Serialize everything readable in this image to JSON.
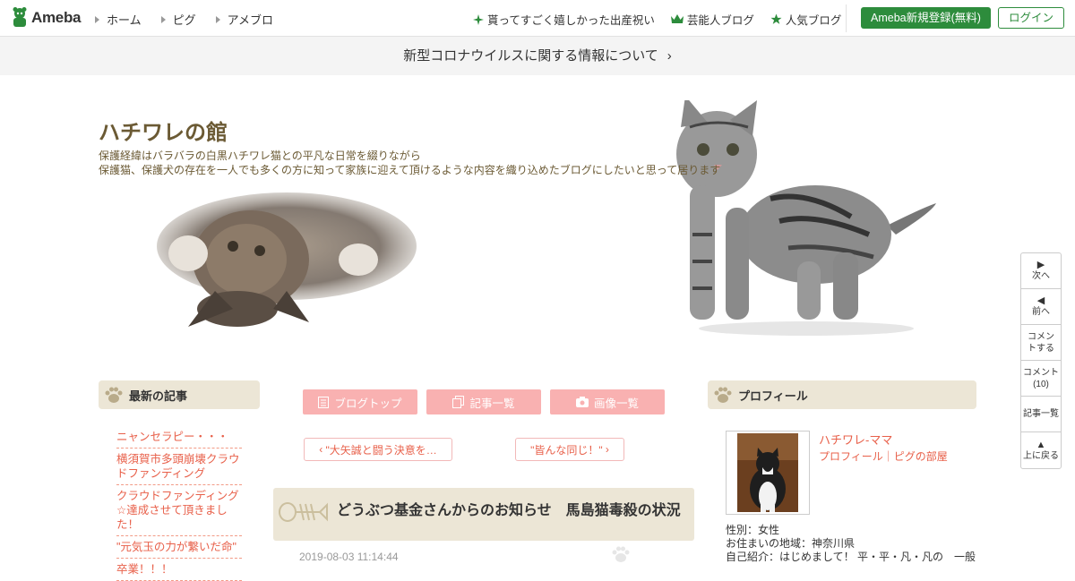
{
  "topbar": {
    "logo_text": "Ameba",
    "nav_left": [
      "ホーム",
      "ピグ",
      "アメブロ"
    ],
    "nav_right": [
      {
        "icon": "sparkle-icon",
        "label": "貰ってすごく嬉しかった出産祝い"
      },
      {
        "icon": "crown-icon",
        "label": "芸能人ブログ"
      },
      {
        "icon": "star-icon",
        "label": "人気ブログ"
      }
    ],
    "register_label": "Ameba新規登録(無料)",
    "login_label": "ログイン",
    "accent_color": "#2d8c3c"
  },
  "notice": {
    "text": "新型コロナウイルスに関する情報について"
  },
  "header": {
    "title": "ハチワレの館",
    "desc_line1": "保護経緯はバラバラの白黒ハチワレ猫との平凡な日常を綴りながら",
    "desc_line2": "保護猫、保護犬の存在を一人でも多くの方に知って家族に迎えて頂けるような内容を織り込めたブログにしたいと思って居ります"
  },
  "sidenav": [
    {
      "icon": "play-right-icon",
      "label": "次へ"
    },
    {
      "icon": "play-left-icon",
      "label": "前へ"
    },
    {
      "icon": "",
      "label": "コメントする"
    },
    {
      "icon": "",
      "label": "コメント(10)"
    },
    {
      "icon": "",
      "label": "記事一覧"
    },
    {
      "icon": "arrow-up-icon",
      "label": "上に戻る"
    }
  ],
  "latest": {
    "heading": "最新の記事",
    "items": [
      "ニャンセラピー・・・",
      "横須賀市多頭崩壊クラウドファンディング",
      "クラウドファンディング☆達成させて頂きました！",
      "\"元気玉の力が繋いだ命\"",
      "卒業！！！"
    ]
  },
  "tabs": [
    {
      "icon": "document-icon",
      "label": "ブログトップ"
    },
    {
      "icon": "copy-icon",
      "label": "記事一覧"
    },
    {
      "icon": "camera-icon",
      "label": "画像一覧"
    }
  ],
  "pager": {
    "prev_label": "\"大矢誠と闘う決意を…",
    "next_label": "\"皆んな同じ！\""
  },
  "article": {
    "title": "どうぶつ基金さんからのお知らせ　馬島猫毒殺の状況",
    "date": "2019-08-03 11:14:44"
  },
  "profile": {
    "heading": "プロフィール",
    "name": "ハチワレ-ママ",
    "links": "プロフィール｜ピグの部屋",
    "gender": "性別：女性",
    "location": "お住まいの地域：神奈川県",
    "intro": "自己紹介：はじめまして！ 平・平・凡・凡の　一般"
  }
}
